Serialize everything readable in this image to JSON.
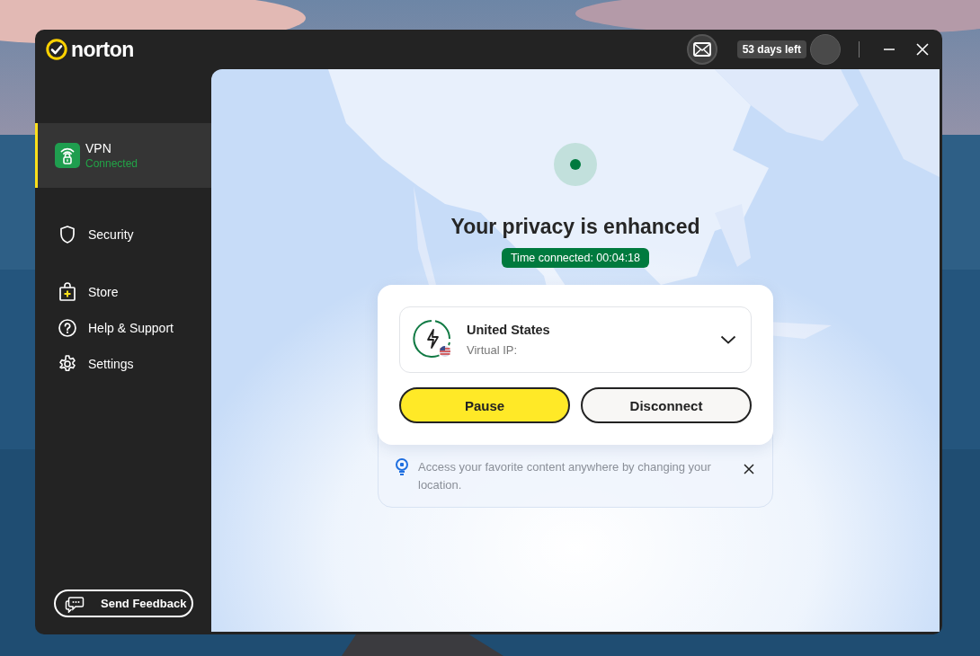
{
  "app": {
    "logo": "norton",
    "days_left": "53 days left"
  },
  "sidebar": {
    "items": [
      {
        "label": "VPN",
        "status": "Connected",
        "selected": true
      },
      {
        "label": "Security",
        "selected": false
      },
      {
        "label": "Store",
        "selected": false
      },
      {
        "label": "Help & Support",
        "selected": false
      },
      {
        "label": "Settings",
        "selected": false
      }
    ],
    "feedback_button": "Send Feedback"
  },
  "vpn": {
    "headline": "Your privacy is enhanced",
    "time_connected": "Time connected: 00:04:18",
    "location": {
      "name": "United States",
      "detail": "Virtual IP:"
    },
    "buttons": [
      {
        "label": "Pause",
        "kind": "primary"
      },
      {
        "label": "Disconnect",
        "kind": "secondary"
      }
    ],
    "tip": "Access your favorite content anywhere by changing your location."
  }
}
